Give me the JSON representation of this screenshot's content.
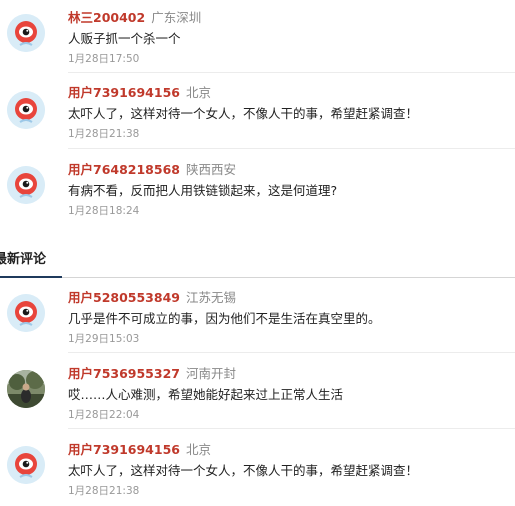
{
  "colors": {
    "username": "#c0392b",
    "location": "#888888",
    "time": "#999999",
    "tab_underline": "#1f3a5c"
  },
  "section_title": "最新评论",
  "top_comments": [
    {
      "user": "林三200402",
      "location": "广东深圳",
      "text": "人贩子抓一个杀一个",
      "time": "1月28日17:50",
      "avatar": "weibo-default-avatar"
    },
    {
      "user": "用户7391694156",
      "location": "北京",
      "text": "太吓人了，这样对待一个女人，不像人干的事，希望赶紧调查！",
      "time": "1月28日21:38",
      "avatar": "weibo-default-avatar"
    },
    {
      "user": "用户7648218568",
      "location": "陕西西安",
      "text": "有病不看，反而把人用铁链锁起来，这是何道理?",
      "time": "1月28日18:24",
      "avatar": "weibo-default-avatar"
    }
  ],
  "latest_comments": [
    {
      "user": "用户5280553849",
      "location": "江苏无锡",
      "text": "几乎是件不可成立的事，因为他们不是生活在真空里的。",
      "time": "1月29日15:03",
      "avatar": "weibo-default-avatar"
    },
    {
      "user": "用户7536955327",
      "location": "河南开封",
      "text": "哎……人心难测，希望她能好起来过上正常人生活",
      "time": "1月28日22:04",
      "avatar": "photo-avatar"
    },
    {
      "user": "用户7391694156",
      "location": "北京",
      "text": "太吓人了，这样对待一个女人，不像人干的事，希望赶紧调查！",
      "time": "1月28日21:38",
      "avatar": "weibo-default-avatar"
    }
  ]
}
